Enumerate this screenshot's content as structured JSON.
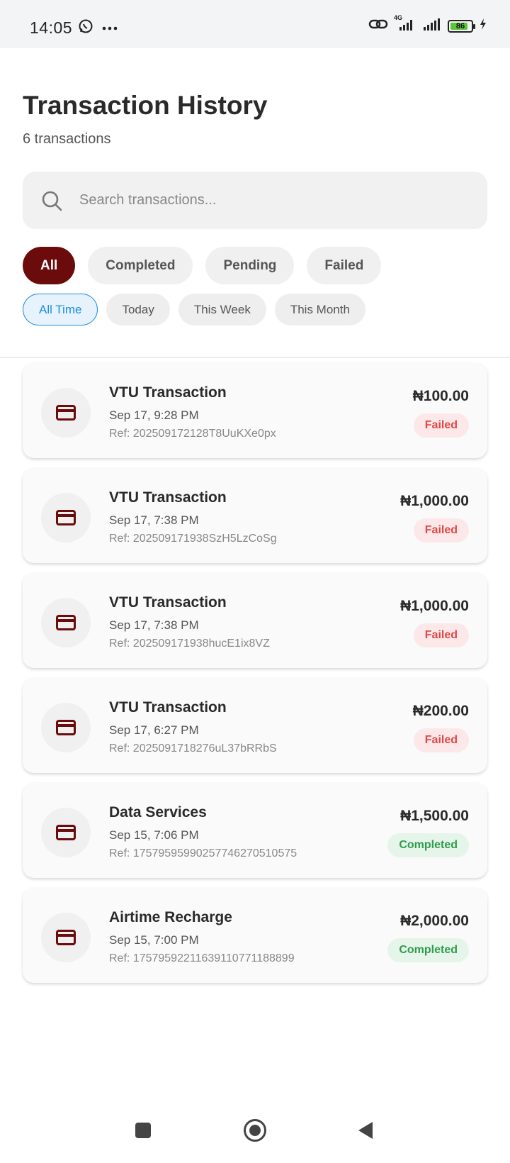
{
  "status_bar": {
    "time": "14:05",
    "battery": "86",
    "battery_level": 0.86,
    "network": "4G",
    "icons": [
      "whatsapp-icon",
      "more-dots-icon",
      "link-icon",
      "signal-icon",
      "battery-icon",
      "charging-icon"
    ]
  },
  "header": {
    "title": "Transaction History",
    "subtitle": "6 transactions"
  },
  "search": {
    "placeholder": "Search transactions..."
  },
  "status_filters": [
    "All",
    "Completed",
    "Pending",
    "Failed"
  ],
  "status_filter_selected": "All",
  "time_filters": [
    "All Time",
    "Today",
    "This Week",
    "This Month"
  ],
  "time_filter_selected": "All Time",
  "colors": {
    "accent": "#6b0b0b",
    "time_accent": "#1f8de0",
    "failed": "#e04848",
    "completed": "#2f9c4b"
  },
  "transactions": [
    {
      "title": "VTU Transaction",
      "date": "Sep 17, 9:28 PM",
      "ref": "Ref: 202509172128T8UuKXe0px",
      "amount": "₦100.00",
      "status": "Failed",
      "icon": "card-icon"
    },
    {
      "title": "VTU Transaction",
      "date": "Sep 17, 7:38 PM",
      "ref": "Ref: 202509171938SzH5LzCoSg",
      "amount": "₦1,000.00",
      "status": "Failed",
      "icon": "card-icon"
    },
    {
      "title": "VTU Transaction",
      "date": "Sep 17, 7:38 PM",
      "ref": "Ref: 202509171938hucE1ix8VZ",
      "amount": "₦1,000.00",
      "status": "Failed",
      "icon": "card-icon"
    },
    {
      "title": "VTU Transaction",
      "date": "Sep 17, 6:27 PM",
      "ref": "Ref: 2025091718276uL37bRRbS",
      "amount": "₦200.00",
      "status": "Failed",
      "icon": "card-icon"
    },
    {
      "title": "Data Services",
      "date": "Sep 15, 7:06 PM",
      "ref": "Ref: 17579595990257746270510575",
      "amount": "₦1,500.00",
      "status": "Completed",
      "icon": "card-icon"
    },
    {
      "title": "Airtime Recharge",
      "date": "Sep 15, 7:00 PM",
      "ref": "Ref: 17579592211639110771188899",
      "amount": "₦2,000.00",
      "status": "Completed",
      "icon": "card-icon"
    }
  ],
  "nav": [
    "recents-square-icon",
    "home-circle-icon",
    "back-triangle-icon"
  ]
}
